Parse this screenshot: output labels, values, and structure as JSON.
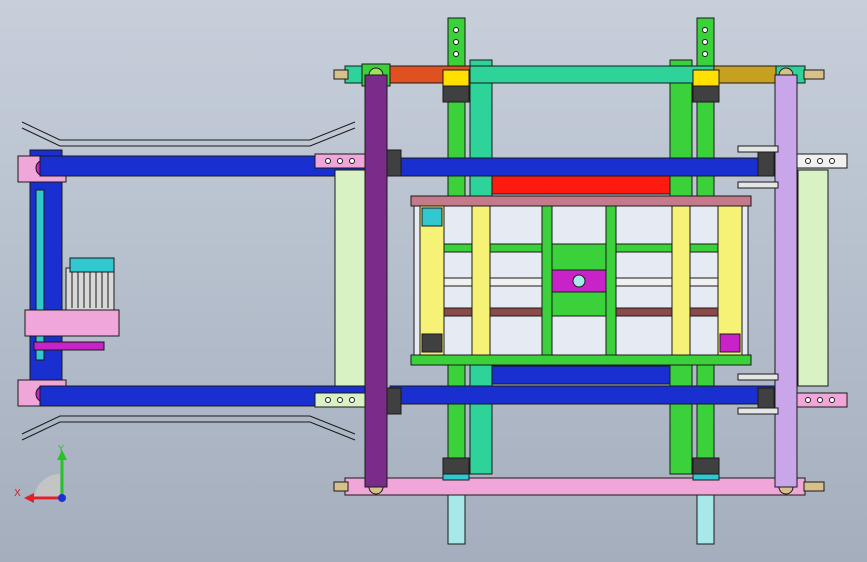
{
  "viewport": {
    "background_top": "#c9d1dd",
    "background_bottom": "#a3adbc"
  },
  "triad": {
    "x_label": "X",
    "y_label": "Y",
    "x_color": "#e0202a",
    "y_color": "#27c427",
    "z_color": "#2030d0"
  },
  "colors": {
    "outline": "#1a1a1a",
    "blue_rail": "#1a2fd0",
    "green_rail": "#2ed39a",
    "lime_column": "#3ad13a",
    "purple_column": "#7a2c8a",
    "lavender_column": "#c9a6ea",
    "pink_beam": "#f0a6d8",
    "yellow_bar": "#f6f275",
    "red_plate": "#ff1a10",
    "pale_green_frame": "#d9f2c4",
    "motor_cyan": "#32c8d0",
    "magenta_block": "#c823c8",
    "light_teal": "#a8e8e8",
    "dark_block": "#404040",
    "tan_cap": "#d8c08a",
    "olive": "#c8a020",
    "orange_red": "#e05020"
  }
}
